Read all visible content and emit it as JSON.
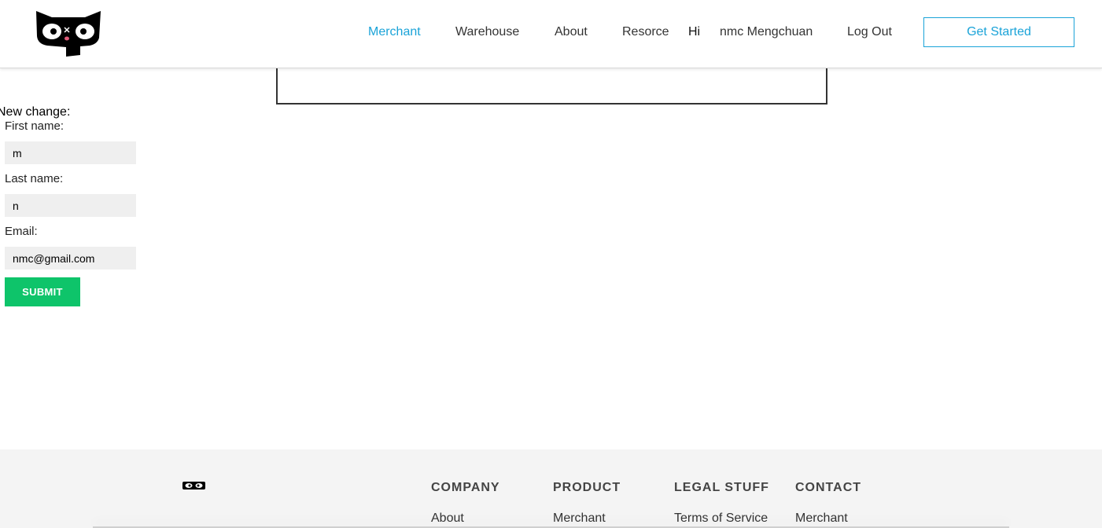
{
  "header": {
    "nav": {
      "merchant": "Merchant",
      "warehouse": "Warehouse",
      "about": "About",
      "resource": "Resorce"
    },
    "greeting": "Hi",
    "username": "nmc Mengchuan",
    "logout": "Log Out",
    "cta": "Get Started",
    "accent_color": "#1aa3d8"
  },
  "form": {
    "title": "New change:",
    "first_name_label": "First name:",
    "first_name_value": "m",
    "last_name_label": "Last name:",
    "last_name_value": "n",
    "email_label": "Email:",
    "email_value": "nmc@gmail.com",
    "submit_label": "SUBMIT",
    "submit_color": "#0ec46a"
  },
  "footer": {
    "headings": {
      "company": "COMPANY",
      "product": "PRODUCT",
      "legal": "LEGAL STUFF",
      "contact": "CONTACT"
    },
    "links": {
      "company_about": "About",
      "product_merchant": "Merchant",
      "legal_terms": "Terms of Service",
      "contact_merchant": "Merchant"
    }
  }
}
